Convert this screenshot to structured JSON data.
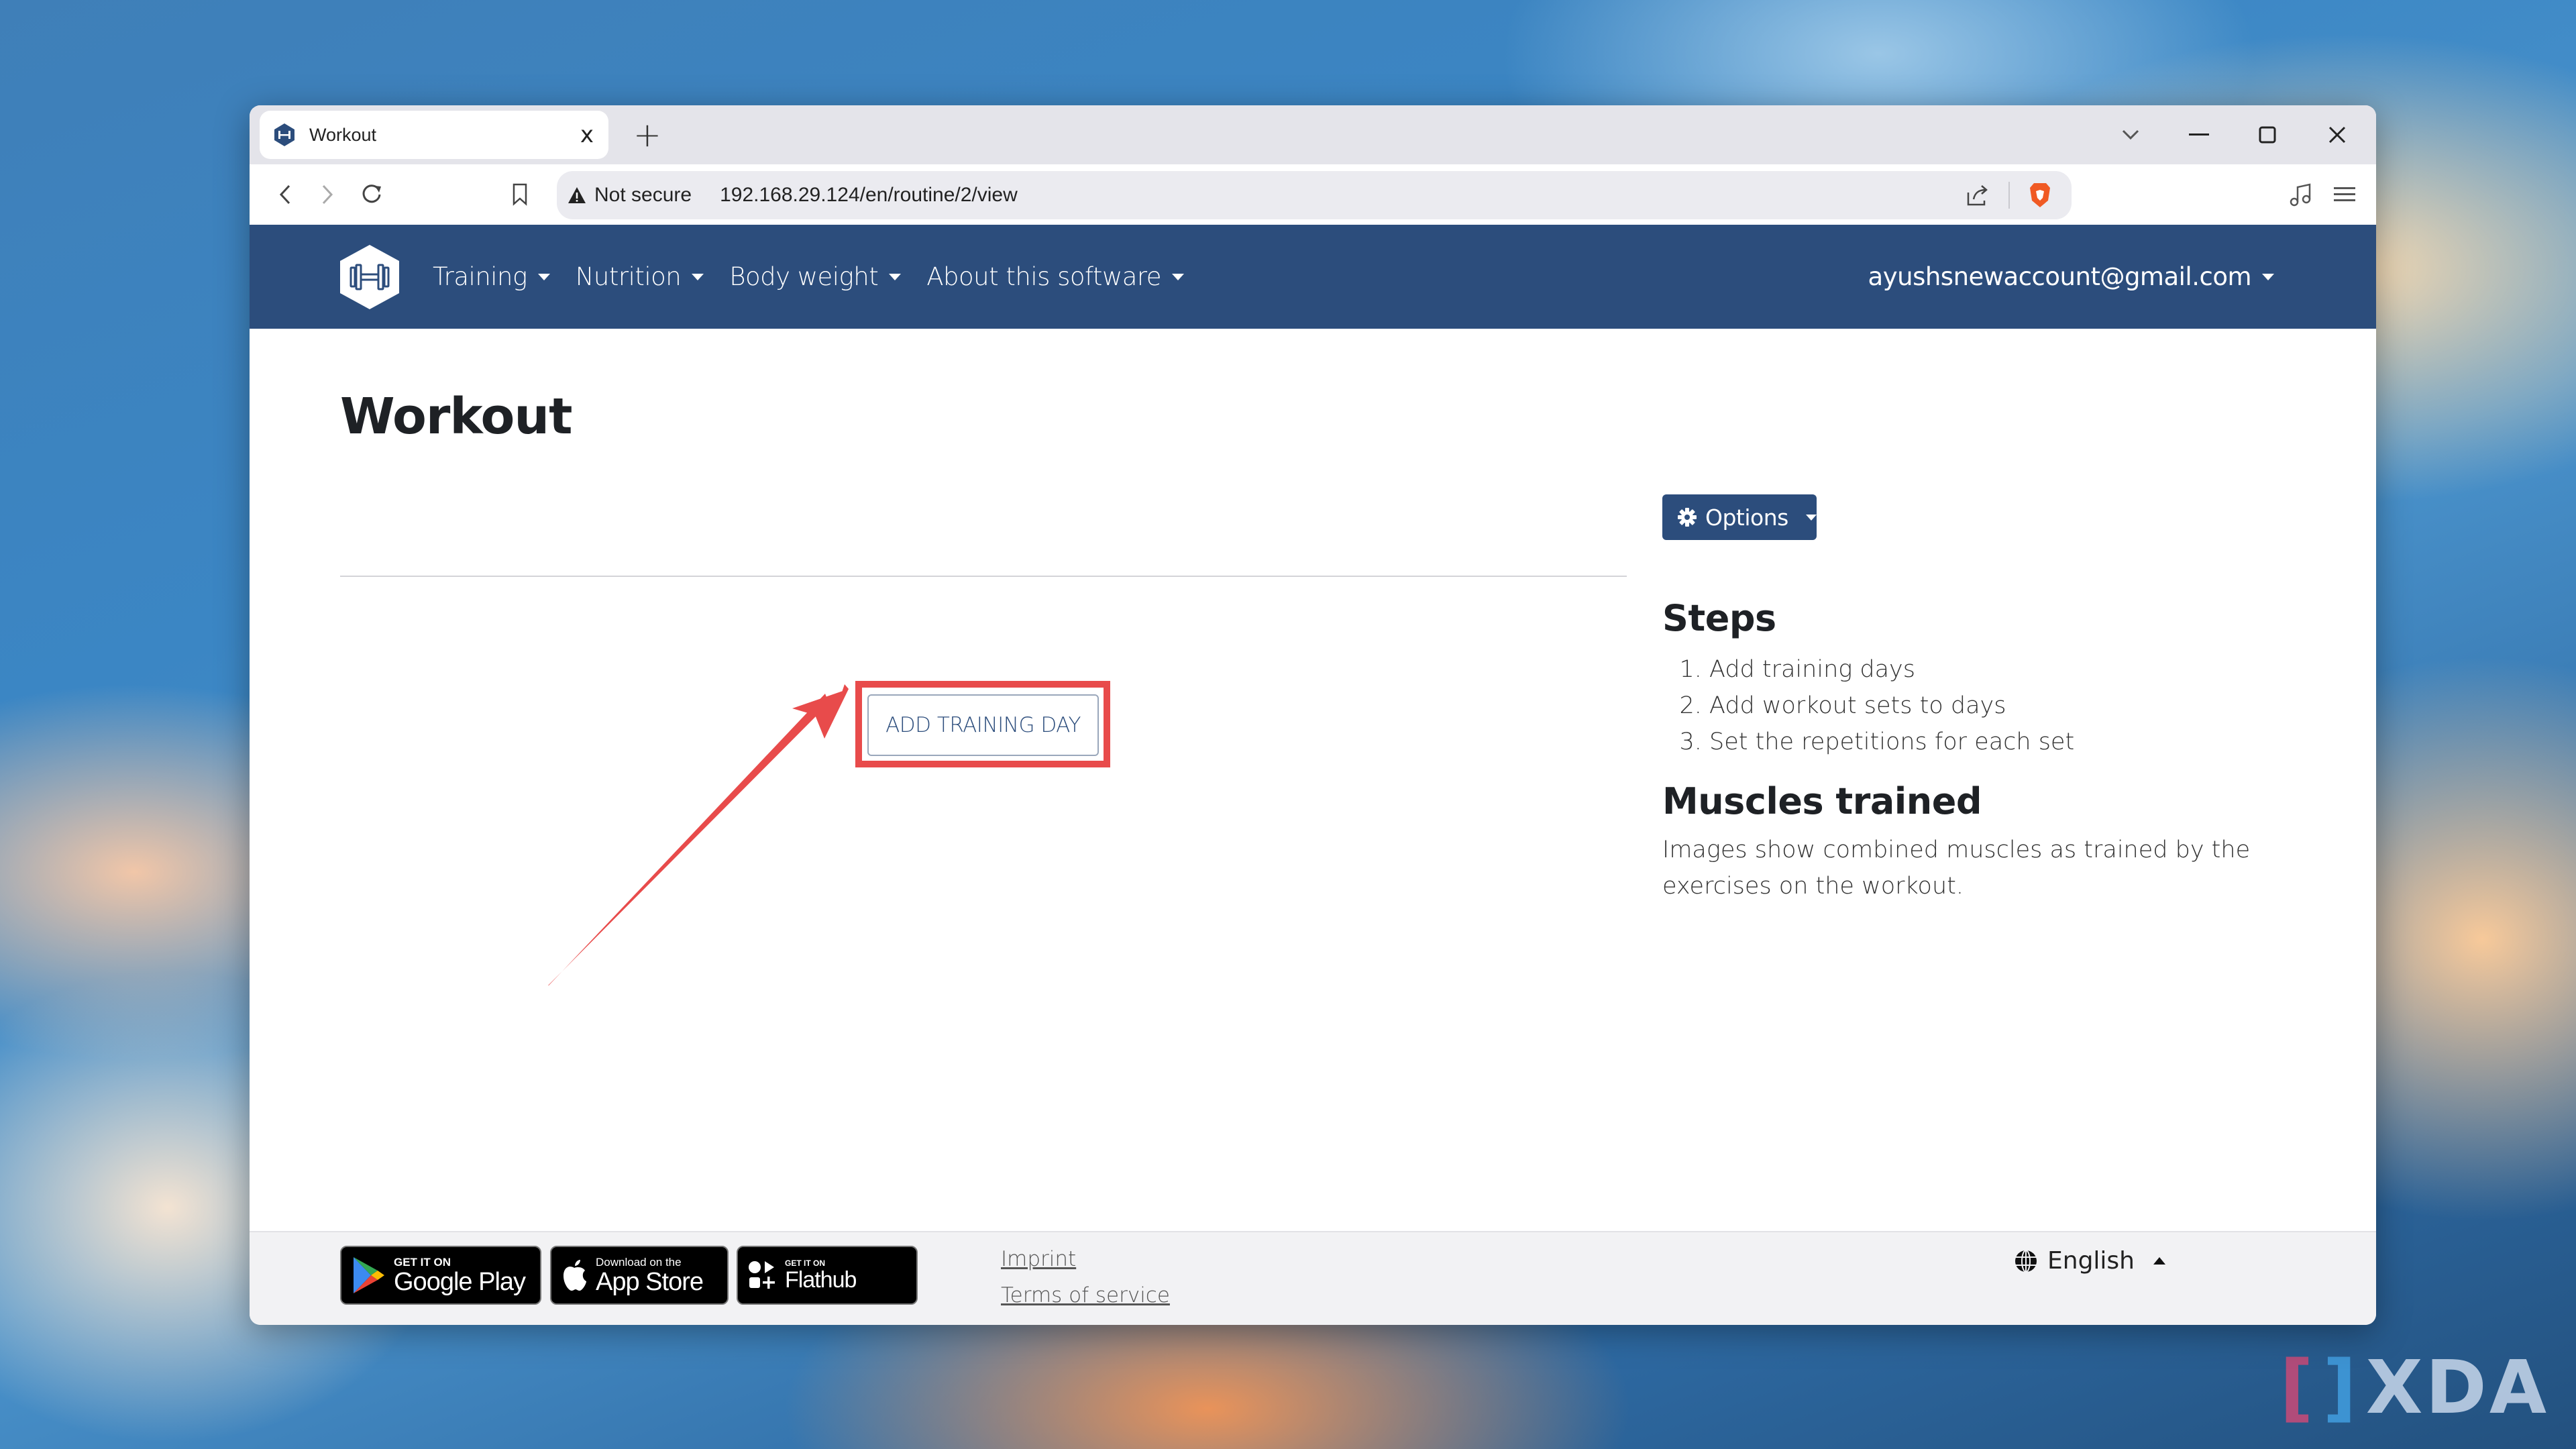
{
  "browser": {
    "tab": {
      "title": "Workout",
      "close_label": "x"
    },
    "new_tab_label": "+",
    "security_label": "Not secure",
    "url": "192.168.29.124/en/routine/2/view"
  },
  "navbar": {
    "items": [
      {
        "label": "Training"
      },
      {
        "label": "Nutrition"
      },
      {
        "label": "Body weight"
      },
      {
        "label": "About this software"
      }
    ],
    "user": "ayushsnewaccount@gmail.com"
  },
  "main": {
    "title": "Workout",
    "add_training_day_label": "ADD TRAINING DAY",
    "annotation_color": "#e84b4b"
  },
  "sidebar": {
    "options_label": "Options",
    "steps_title": "Steps",
    "steps": [
      "Add training days",
      "Add workout sets to days",
      "Set the repetitions for each set"
    ],
    "muscles_title": "Muscles trained",
    "muscles_text": "Images show combined muscles as trained by the exercises on the workout."
  },
  "footer": {
    "badges": [
      {
        "small": "GET IT ON",
        "big": "Google Play"
      },
      {
        "small": "Download on the",
        "big": "App Store"
      },
      {
        "small": "GET IT ON",
        "big": "Flathub"
      }
    ],
    "links": [
      "Imprint",
      "Terms of service"
    ],
    "language": "English"
  },
  "watermark": "XDA",
  "colors": {
    "brand": "#2c4d7c",
    "annotation": "#e84b4b",
    "footer_bg": "#f2f2f4"
  }
}
